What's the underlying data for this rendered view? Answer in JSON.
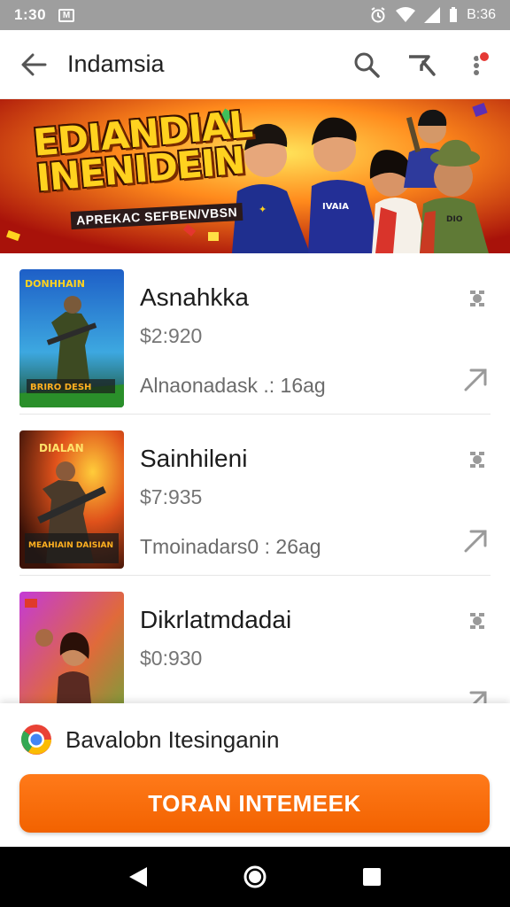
{
  "status_bar": {
    "time": "1:30",
    "notif": "M",
    "battery_text": "B:36"
  },
  "app_bar": {
    "title": "Indamsia"
  },
  "banner": {
    "title": "EDIANDIAL INENIDEIN",
    "subtitle": "APREKAC SEFBEN/VBSN"
  },
  "items": [
    {
      "name": "Asnahkka",
      "price": "$2:920",
      "meta": "Alnaonadask .: 16ag",
      "thumb_top": "DONHHAIN",
      "thumb_bottom": "BRIRO DESH"
    },
    {
      "name": "Sainhileni",
      "price": "$7:935",
      "meta": "Tmoinadars0  : 26ag",
      "thumb_top": "DIALAN",
      "thumb_bottom": "MEAHIAIN DAISIAN"
    },
    {
      "name": "Dikrlatmdadai",
      "price": "$0:930",
      "meta": "",
      "thumb_top": "",
      "thumb_bottom": ""
    }
  ],
  "bottom_sheet": {
    "source_label": "Bavalobn Itesinganin",
    "cta_label": "TORAN INTEMEEK"
  },
  "colors": {
    "accent": "#f26200",
    "status_bar": "#9e9e9e"
  }
}
